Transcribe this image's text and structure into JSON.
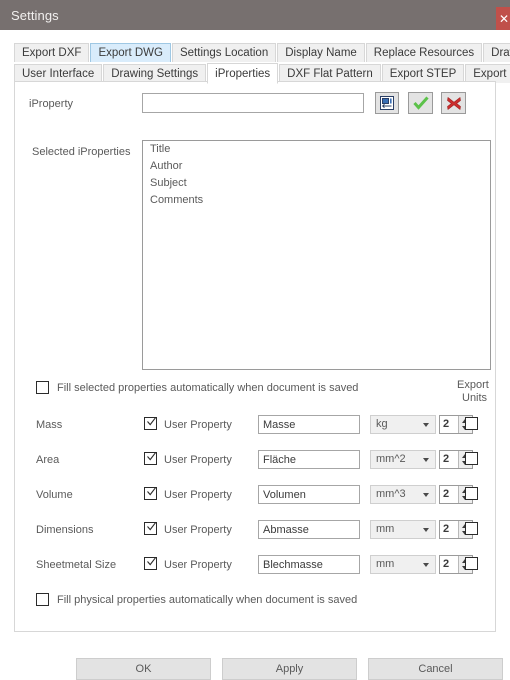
{
  "window": {
    "title": "Settings",
    "close_label": "✕"
  },
  "tabs": {
    "row1": [
      {
        "label": "Export DXF",
        "state": "normal"
      },
      {
        "label": "Export DWG",
        "state": "hover"
      },
      {
        "label": "Settings Location",
        "state": "normal"
      },
      {
        "label": "Display Name",
        "state": "normal"
      },
      {
        "label": "Replace Resources",
        "state": "normal"
      },
      {
        "label": "Drawing functions",
        "state": "normal"
      }
    ],
    "row2": [
      {
        "label": "User Interface",
        "state": "normal"
      },
      {
        "label": "Drawing Settings",
        "state": "normal"
      },
      {
        "label": "iProperties",
        "state": "active"
      },
      {
        "label": "DXF Flat Pattern",
        "state": "normal"
      },
      {
        "label": "Export STEP",
        "state": "normal"
      },
      {
        "label": "Export PDF",
        "state": "normal"
      }
    ]
  },
  "iproperty": {
    "label": "iProperty",
    "value": "",
    "placeholder": "",
    "browse_icon": "form-icon",
    "accept_icon": "check-icon",
    "reject_icon": "cross-icon"
  },
  "selected_iproperties": {
    "label": "Selected iProperties",
    "items": [
      "Title",
      "Author",
      "Subject",
      "Comments"
    ]
  },
  "fill_selected": {
    "label": "Fill selected properties automatically when document is saved",
    "checked": false
  },
  "export_units_header": {
    "line1": "Export",
    "line2": "Units"
  },
  "property_rows": [
    {
      "name": "Mass",
      "user_property_label": "User Property",
      "user_property_checked": true,
      "field_value": "Masse",
      "unit": "kg",
      "precision": "2",
      "export_units_checked": false
    },
    {
      "name": "Area",
      "user_property_label": "User Property",
      "user_property_checked": true,
      "field_value": "Fläche",
      "unit": "mm^2",
      "precision": "2",
      "export_units_checked": false
    },
    {
      "name": "Volume",
      "user_property_label": "User Property",
      "user_property_checked": true,
      "field_value": "Volumen",
      "unit": "mm^3",
      "precision": "2",
      "export_units_checked": false
    },
    {
      "name": "Dimensions",
      "user_property_label": "User Property",
      "user_property_checked": true,
      "field_value": "Abmasse",
      "unit": "mm",
      "precision": "2",
      "export_units_checked": false
    },
    {
      "name": "Sheetmetal Size",
      "user_property_label": "User Property",
      "user_property_checked": true,
      "field_value": "Blechmasse",
      "unit": "mm",
      "precision": "2",
      "export_units_checked": false
    }
  ],
  "fill_physical": {
    "label": "Fill physical properties automatically when document is saved",
    "checked": false
  },
  "footer": {
    "ok": "OK",
    "apply": "Apply",
    "cancel": "Cancel"
  },
  "colors": {
    "titlebar": "#77706f",
    "close": "#c0504a",
    "tab_hover": "#d9ecfb",
    "accept_green": "#5cc24a",
    "reject_red": "#cc2f2f",
    "text": "#5a5a5a"
  }
}
